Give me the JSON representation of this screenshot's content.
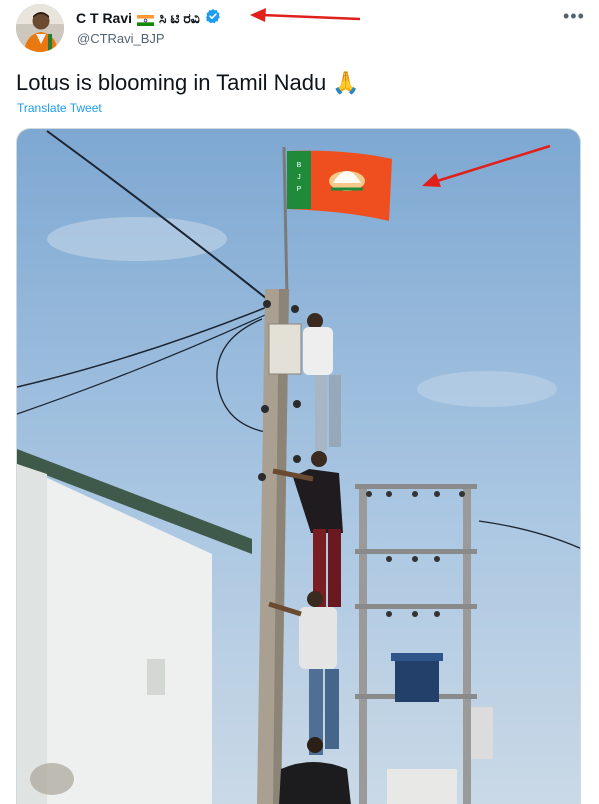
{
  "tweet": {
    "author": {
      "display_name": "C T Ravi",
      "name_script": "ಸಿ ಟಿ ರವಿ",
      "handle": "@CTRavi_BJP",
      "flag_icon": "india-flag-icon",
      "verified_icon": "verified-badge-icon",
      "verified_color": "#1d9bf0"
    },
    "more_icon": "more-options-icon",
    "more_glyph": "•••",
    "text": "Lotus is blooming in Tamil Nadu 🙏",
    "translate_label": "Translate Tweet",
    "media": {
      "flag_lettering": [
        "B",
        "J",
        "P"
      ]
    }
  },
  "annotations": {
    "arrow_color": "#e0201b"
  }
}
